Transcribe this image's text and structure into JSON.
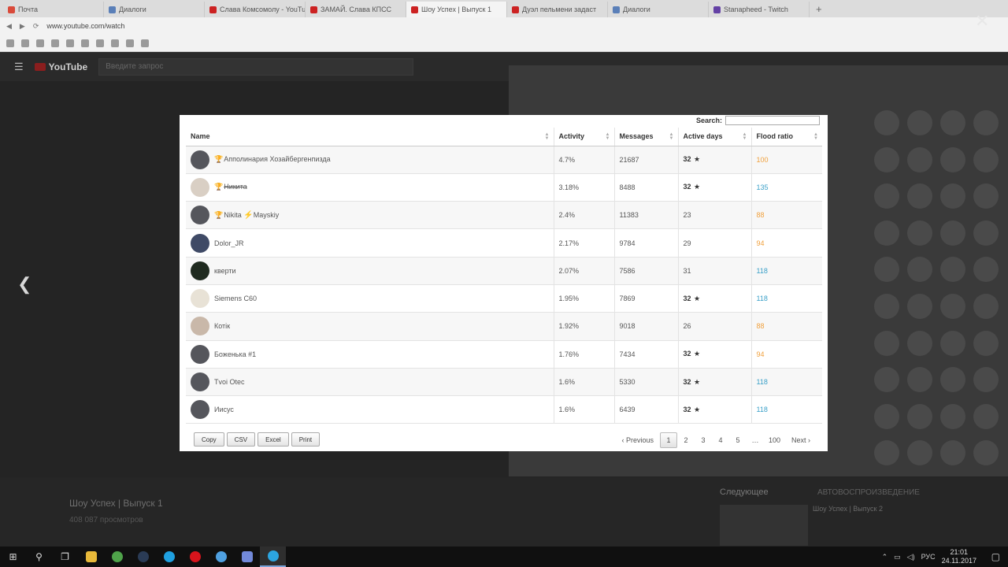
{
  "browser": {
    "tabs": [
      {
        "label": "Почта",
        "color": "#d94a3a"
      },
      {
        "label": "Диалоги",
        "color": "#5a7fb8"
      },
      {
        "label": "Слава Комсомолу - YouTube",
        "color": "#cc2222"
      },
      {
        "label": "ЗАМАЙ. Слава КПСС",
        "color": "#cc2222"
      },
      {
        "label": "Шоу Успех | Выпуск 1",
        "color": "#cc2222",
        "active": true
      },
      {
        "label": "Дуэл пельмени задаст",
        "color": "#cc2222"
      },
      {
        "label": "Диалоги",
        "color": "#5a7fb8"
      },
      {
        "label": "Stanapheed - Twitch",
        "color": "#6441a5"
      }
    ],
    "address": "www.youtube.com/watch"
  },
  "youtube": {
    "logo": "YouTube",
    "search_placeholder": "Введите запрос",
    "video_title": "Шоу Успех | Выпуск 1",
    "views": "408 087 просмотров",
    "up_next": "Следующее",
    "autoplay": "АВТОВОСПРОИЗВЕДЕНИЕ",
    "next_video": "Шоу Успех | Выпуск 2"
  },
  "modal": {
    "search_label": "Search:",
    "search_value": "",
    "columns": [
      "Name",
      "Activity",
      "Messages",
      "Active days",
      "Flood ratio"
    ],
    "rows": [
      {
        "name": "Апполинария Хозайбергенпизда",
        "trophy": "gold",
        "activity": "4.7%",
        "messages": "21687",
        "days": "32",
        "star": true,
        "flood": "100",
        "flood_color": "orange",
        "avatar": "#55565c"
      },
      {
        "name": "Никита",
        "trophy": "grey",
        "strike": true,
        "activity": "3.18%",
        "messages": "8488",
        "days": "32",
        "star": true,
        "flood": "135",
        "flood_color": "blue",
        "avatar": "#d9cfc4"
      },
      {
        "name": "Nikita",
        "name2": "Mayskiy",
        "trophy": "gold",
        "bolt": true,
        "activity": "2.4%",
        "messages": "11383",
        "days": "23",
        "star": false,
        "flood": "88",
        "flood_color": "orange",
        "avatar": "#55565c"
      },
      {
        "name": "Dolor_JR",
        "activity": "2.17%",
        "messages": "9784",
        "days": "29",
        "star": false,
        "flood": "94",
        "flood_color": "orange",
        "avatar": "#3f4a66"
      },
      {
        "name": "кверти",
        "activity": "2.07%",
        "messages": "7586",
        "days": "31",
        "star": false,
        "flood": "118",
        "flood_color": "blue",
        "avatar": "#1f2a1f"
      },
      {
        "name": "Siemens C60",
        "activity": "1.95%",
        "messages": "7869",
        "days": "32",
        "star": true,
        "flood": "118",
        "flood_color": "blue",
        "avatar": "#e8e2d6"
      },
      {
        "name": "Котік",
        "activity": "1.92%",
        "messages": "9018",
        "days": "26",
        "star": false,
        "flood": "88",
        "flood_color": "orange",
        "avatar": "#c9b8a9"
      },
      {
        "name": "Боженька #1",
        "activity": "1.76%",
        "messages": "7434",
        "days": "32",
        "star": true,
        "flood": "94",
        "flood_color": "orange",
        "avatar": "#55565c"
      },
      {
        "name": "Tvoi Otec",
        "activity": "1.6%",
        "messages": "5330",
        "days": "32",
        "star": true,
        "flood": "118",
        "flood_color": "blue",
        "avatar": "#55565c"
      },
      {
        "name": "Иисус",
        "activity": "1.6%",
        "messages": "6439",
        "days": "32",
        "star": true,
        "flood": "118",
        "flood_color": "blue",
        "avatar": "#55565c"
      }
    ],
    "export_buttons": [
      "Copy",
      "CSV",
      "Excel",
      "Print"
    ],
    "pagination": {
      "previous": "Previous",
      "pages": [
        "1",
        "2",
        "3",
        "4",
        "5",
        "…",
        "100"
      ],
      "current": "1",
      "next": "Next"
    }
  },
  "taskbar": {
    "lang": "РУС",
    "time": "21:01",
    "date": "24.11.2017"
  },
  "colors": {
    "flood_orange": "#f0a03c",
    "flood_blue": "#3aa0c8",
    "trophy_gold": "#c8911e"
  }
}
